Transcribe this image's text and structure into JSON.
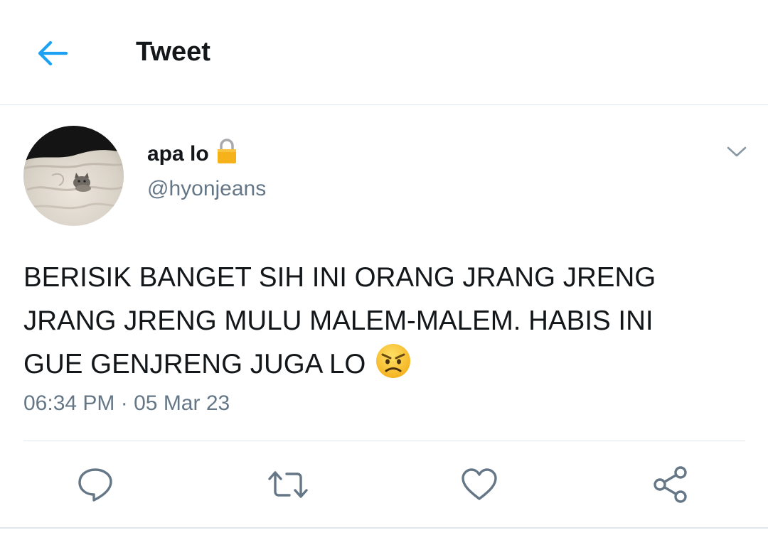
{
  "header": {
    "title": "Tweet",
    "back_icon": "arrow-left-icon"
  },
  "tweet": {
    "author": {
      "display_name": "apa lo",
      "handle": "@hyonjeans",
      "protected_icon": "lock-icon",
      "avatar": "cat-on-bed-avatar"
    },
    "text_lines": [
      "BERISIK BANGET SIH INI ORANG JRANG JRENG",
      "JRANG JRENG MULU MALEM-MALEM. HABIS INI",
      "GUE GENJRENG JUGA LO"
    ],
    "emoji": "angry-face-emoji",
    "time": "06:34 PM",
    "separator": "·",
    "date": "05 Mar 23"
  },
  "actions": [
    "reply-icon",
    "retweet-icon",
    "like-icon",
    "share-icon"
  ],
  "colors": {
    "accent": "#1da1f2",
    "text": "#14171a",
    "secondary": "#657786",
    "border": "#e1e8ed"
  }
}
